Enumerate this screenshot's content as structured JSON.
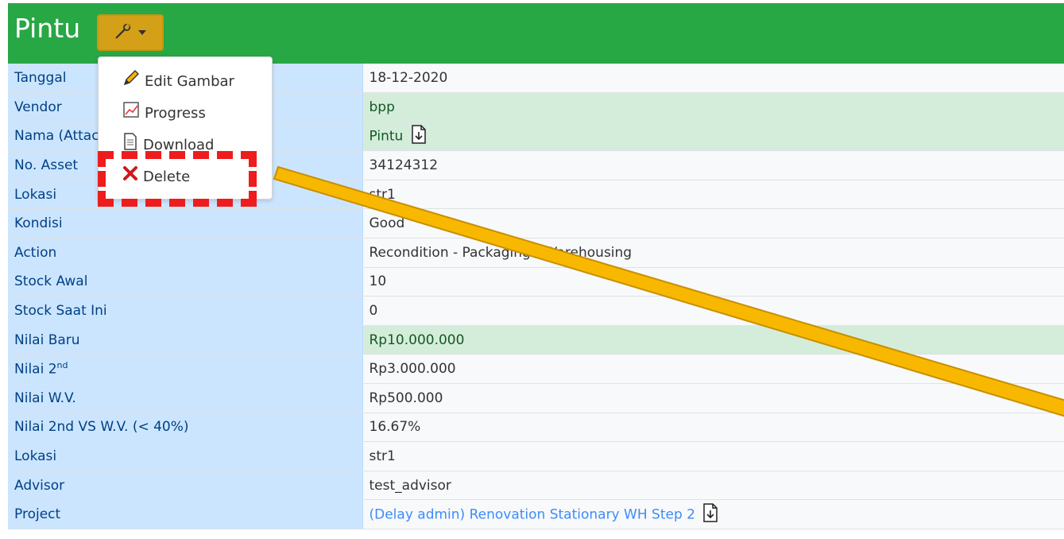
{
  "header": {
    "title": "Pintu"
  },
  "menu": {
    "edit": "Edit Gambar",
    "progress": "Progress",
    "download": "Download",
    "delete": "Delete"
  },
  "rows": [
    {
      "label": "Tanggal",
      "value": "18-12-2020"
    },
    {
      "label": "Vendor",
      "value": "bpp"
    },
    {
      "label": "Nama (Attachment)",
      "value": "Pintu"
    },
    {
      "label": "No. Asset",
      "value": "34124312"
    },
    {
      "label": "Lokasi",
      "value": "str1"
    },
    {
      "label": "Kondisi",
      "value": "Good"
    },
    {
      "label": "Action",
      "value": "Recondition - Packaging - Warehousing"
    },
    {
      "label": "Stock Awal",
      "value": "10"
    },
    {
      "label": "Stock Saat Ini",
      "value": "0"
    },
    {
      "label": "Nilai Baru",
      "value": "Rp10.000.000"
    },
    {
      "label": "Nilai 2",
      "label_sup": "nd",
      "value": "Rp3.000.000"
    },
    {
      "label": "Nilai W.V.",
      "value": "Rp500.000"
    },
    {
      "label": "Nilai 2nd VS W.V. (< 40%)",
      "value": "16.67%"
    },
    {
      "label": "Lokasi",
      "value": "str1"
    },
    {
      "label": "Advisor",
      "value": "test_advisor"
    },
    {
      "label": "Project",
      "value": "(Delay admin) Renovation Stationary WH Step 2"
    }
  ],
  "colors": {
    "header": "#28a745",
    "tool_button": "#d4a017",
    "label_bg": "#cce5ff",
    "highlight_bg": "#d4edda",
    "dashed_box": "#ee1c1c",
    "arrow": "#f9b800"
  }
}
